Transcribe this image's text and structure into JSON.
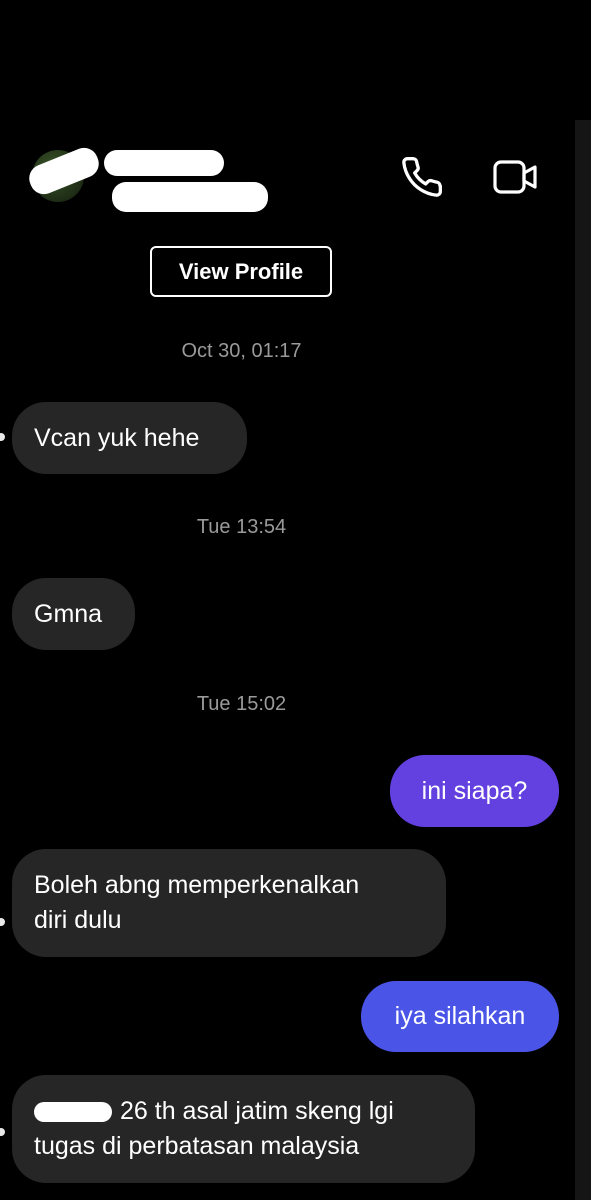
{
  "header": {
    "actions": [
      {
        "name": "phone-icon"
      },
      {
        "name": "video-camera-icon"
      }
    ]
  },
  "profile": {
    "view_profile_label": "View Profile"
  },
  "messages": {
    "ts_1": "Oct 30, 01:17",
    "m1": "Vcan yuk hehe",
    "ts_2": "Tue 13:54",
    "m2": "Gmna",
    "ts_3": "Tue 15:02",
    "m3": "ini siapa?",
    "m4_line1": "Boleh abng memperkenalkan",
    "m4_line2": "diri dulu",
    "m5": "iya silahkan",
    "m6_line1": "26 th asal jatim skeng lgi",
    "m6_line2": "tugas di perbatasan malaysia"
  },
  "colors": {
    "background": "#000000",
    "incoming_bubble": "#262626",
    "outgoing_bubble_1": "#6340e0",
    "outgoing_bubble_2": "#4a55e8",
    "timestamp": "#9a9a9a"
  }
}
